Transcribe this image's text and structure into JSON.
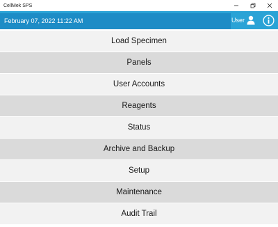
{
  "window": {
    "title": "CellMek SPS"
  },
  "header": {
    "datetime": "February 07, 2022 11:22 AM",
    "user_label": "User",
    "accent_color": "#1d8cc6",
    "bar_color": "#2aa3d6"
  },
  "menu": {
    "items": [
      {
        "label": "Load Specimen"
      },
      {
        "label": "Panels"
      },
      {
        "label": "User Accounts"
      },
      {
        "label": "Reagents"
      },
      {
        "label": "Status"
      },
      {
        "label": "Archive and Backup"
      },
      {
        "label": "Setup"
      },
      {
        "label": "Maintenance"
      },
      {
        "label": "Audit Trail"
      }
    ]
  }
}
